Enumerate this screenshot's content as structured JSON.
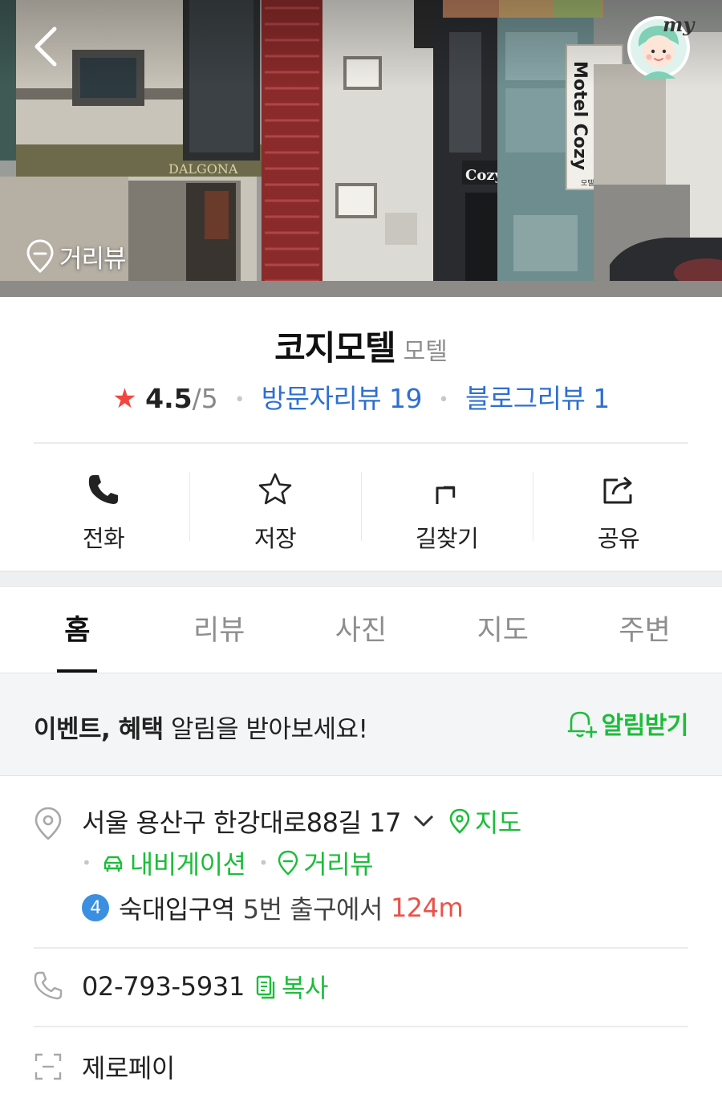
{
  "header": {
    "back_icon": "chevron-left-icon",
    "my_badge": "my",
    "streetview_label": "거리뷰"
  },
  "hero_signage": {
    "left_building": "DALGONA",
    "right_vertical": "Motel Cozy",
    "right_small": "모텔코지",
    "entrance": "Cozy"
  },
  "place": {
    "name": "코지모텔",
    "category": "모텔",
    "rating": "4.5",
    "rating_max": "/5",
    "visitor_reviews": "방문자리뷰 19",
    "blog_reviews": "블로그리뷰 1"
  },
  "actions": [
    {
      "label": "전화",
      "icon": "phone-icon"
    },
    {
      "label": "저장",
      "icon": "star-outline-icon"
    },
    {
      "label": "길찾기",
      "icon": "directions-icon"
    },
    {
      "label": "공유",
      "icon": "share-icon"
    }
  ],
  "tabs": [
    {
      "label": "홈",
      "active": true
    },
    {
      "label": "리뷰",
      "active": false
    },
    {
      "label": "사진",
      "active": false
    },
    {
      "label": "지도",
      "active": false
    },
    {
      "label": "주변",
      "active": false
    }
  ],
  "banner": {
    "text_bold": "이벤트, 혜택",
    "text_rest": " 알림을 받아보세요!",
    "button_label": "알림받기"
  },
  "info": {
    "address": "서울 용산구 한강대로88길 17",
    "map_link": "지도",
    "navigation_link": "내비게이션",
    "streetview_link": "거리뷰",
    "subway_line": "4",
    "station": "숙대입구역",
    "exit_text": "5번 출구에서",
    "distance": "124m",
    "phone": "02-793-5931",
    "copy_label": "복사",
    "zeropay": "제로페이"
  },
  "colors": {
    "accent_green": "#1cbd3a",
    "link_blue": "#2e6fd4",
    "star_red": "#f2473f",
    "distance_red": "#e8524b",
    "subway_line4": "#3a8fe0"
  }
}
